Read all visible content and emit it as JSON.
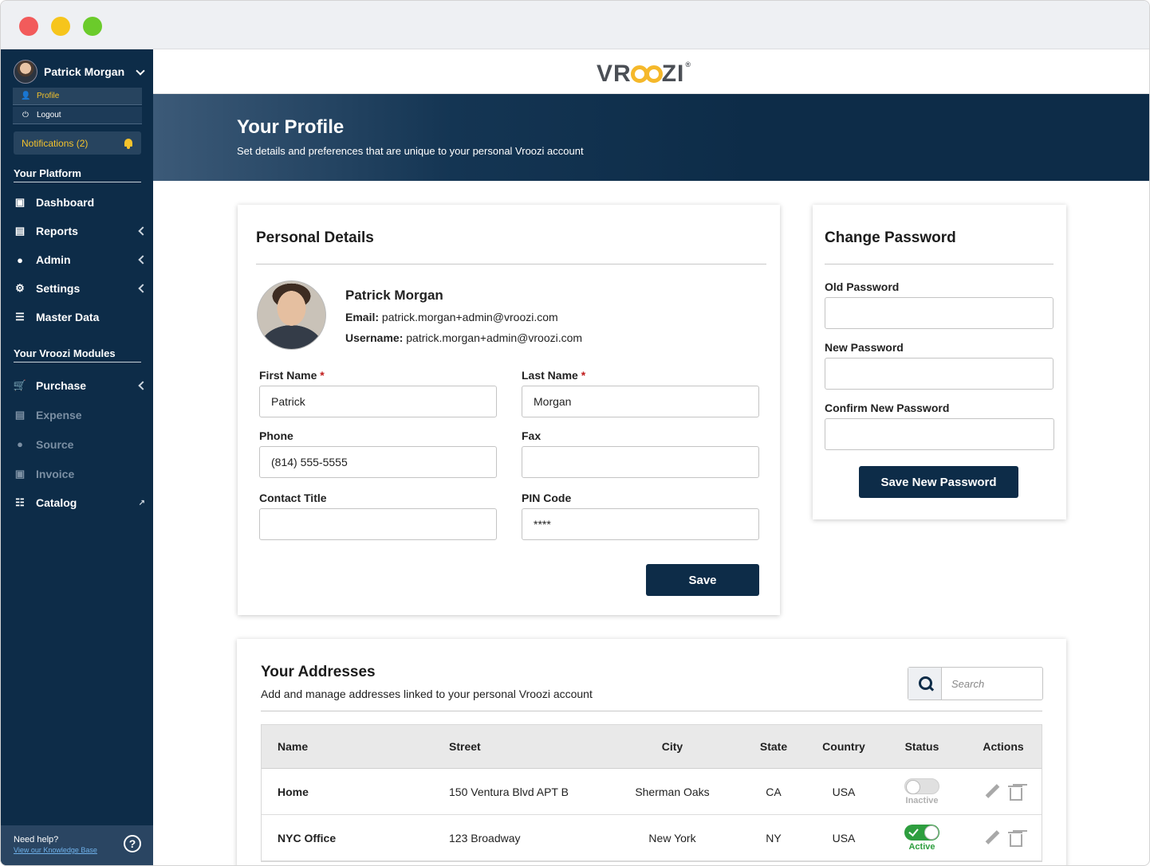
{
  "user": {
    "name": "Patrick Morgan"
  },
  "user_menu": [
    {
      "label": "Profile",
      "icon": "user-icon",
      "active": true
    },
    {
      "label": "Logout",
      "icon": "power-icon",
      "active": false
    }
  ],
  "notifications": {
    "label": "Notifications (2)"
  },
  "platform_section": {
    "title": "Your Platform",
    "items": [
      {
        "label": "Dashboard",
        "icon": "monitor-icon"
      },
      {
        "label": "Reports",
        "icon": "bar-chart-icon"
      },
      {
        "label": "Admin",
        "icon": "users-icon"
      },
      {
        "label": "Settings",
        "icon": "gear-icon"
      },
      {
        "label": "Master Data",
        "icon": "database-icon"
      }
    ]
  },
  "modules_section": {
    "title": "Your Vroozi Modules",
    "items": [
      {
        "label": "Purchase",
        "icon": "cart-icon",
        "enabled": true
      },
      {
        "label": "Expense",
        "icon": "credit-card-icon",
        "enabled": false
      },
      {
        "label": "Source",
        "icon": "map-pin-icon",
        "enabled": false
      },
      {
        "label": "Invoice",
        "icon": "money-icon",
        "enabled": false
      },
      {
        "label": "Catalog",
        "icon": "book-icon",
        "enabled": true
      }
    ]
  },
  "help": {
    "title": "Need help?",
    "link": "View our Knowledge Base"
  },
  "logo": {
    "left": "VR",
    "right": "ZI"
  },
  "hero": {
    "title": "Your Profile",
    "subtitle": "Set details and preferences that are unique to your personal Vroozi account"
  },
  "personal": {
    "title": "Personal Details",
    "name": "Patrick Morgan",
    "email_label": "Email:",
    "email": "patrick.morgan+admin@vroozi.com",
    "username_label": "Username:",
    "username": "patrick.morgan+admin@vroozi.com",
    "first_name_label": "First Name",
    "first_name": "Patrick",
    "last_name_label": "Last Name",
    "last_name": "Morgan",
    "phone_label": "Phone",
    "phone": "(814) 555-5555",
    "fax_label": "Fax",
    "fax": "",
    "contact_title_label": "Contact Title",
    "contact_title": "",
    "pin_label": "PIN Code",
    "pin": "****",
    "save_label": "Save"
  },
  "password": {
    "title": "Change Password",
    "old_label": "Old Password",
    "new_label": "New Password",
    "confirm_label": "Confirm New Password",
    "button_label": "Save New Password"
  },
  "addresses": {
    "title": "Your Addresses",
    "subtitle": "Add and manage addresses linked to your personal Vroozi account",
    "search_placeholder": "Search",
    "columns": [
      "Name",
      "Street",
      "City",
      "State",
      "Country",
      "Status",
      "Actions"
    ],
    "rows": [
      {
        "name": "Home",
        "street": "150 Ventura Blvd APT B",
        "city": "Sherman Oaks",
        "state": "CA",
        "country": "USA",
        "status": "Inactive",
        "active": false
      },
      {
        "name": "NYC Office",
        "street": "123 Broadway",
        "city": "New York",
        "state": "NY",
        "country": "USA",
        "status": "Active",
        "active": true
      }
    ]
  },
  "colors": {
    "navy": "#0d2c48",
    "accent": "#f5c32c",
    "active_green": "#2e9e3f",
    "required_red": "#c01b1b"
  }
}
